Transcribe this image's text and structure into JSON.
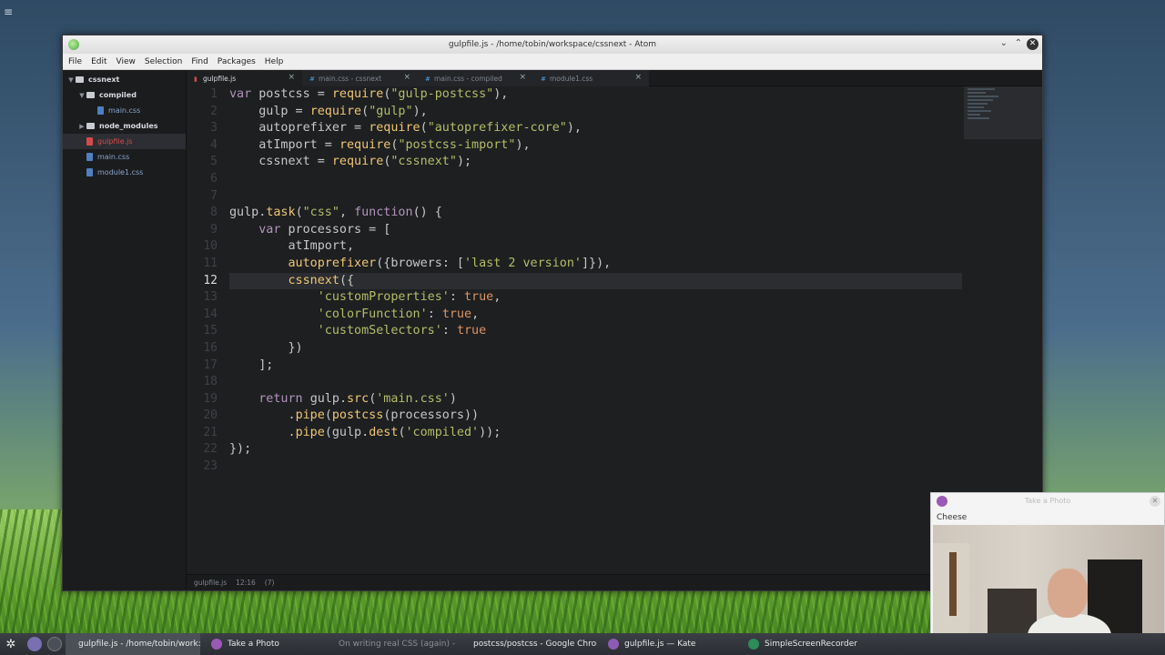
{
  "desktop": {
    "icon_glyph": "≡"
  },
  "atom_window": {
    "title": "gulpfile.js - /home/tobin/workspace/cssnext - Atom",
    "controls": {
      "minimize": "⌄",
      "maximize": "⌃",
      "close": "✕"
    },
    "menu": [
      "File",
      "Edit",
      "View",
      "Selection",
      "Find",
      "Packages",
      "Help"
    ],
    "tree": [
      {
        "label": "cssnext",
        "kind": "folder",
        "depth": 0,
        "expanded": true
      },
      {
        "label": "compiled",
        "kind": "folder",
        "depth": 1,
        "expanded": true
      },
      {
        "label": "main.css",
        "kind": "file",
        "depth": 2
      },
      {
        "label": "node_modules",
        "kind": "folder",
        "depth": 1,
        "expanded": false
      },
      {
        "label": "gulpfile.js",
        "kind": "file",
        "depth": 1,
        "selected": true
      },
      {
        "label": "main.css",
        "kind": "file",
        "depth": 1
      },
      {
        "label": "module1.css",
        "kind": "file",
        "depth": 1
      }
    ],
    "tabs": [
      {
        "label": "gulpfile.js",
        "active": true,
        "close": "×"
      },
      {
        "label": "main.css - cssnext",
        "active": false,
        "close": "×"
      },
      {
        "label": "main.css - compiled",
        "active": false,
        "close": "×"
      },
      {
        "label": "module1.css",
        "active": false,
        "close": "×"
      }
    ],
    "active_line": 12,
    "code_lines": [
      "var postcss = require(\"gulp-postcss\"),",
      "    gulp = require(\"gulp\"),",
      "    autoprefixer = require(\"autoprefixer-core\"),",
      "    atImport = require(\"postcss-import\"),",
      "    cssnext = require(\"cssnext\");",
      "",
      "",
      "gulp.task(\"css\", function() {",
      "    var processors = [",
      "        atImport,",
      "        autoprefixer({browers: ['last 2 version']}),",
      "        cssnext({",
      "            'customProperties': true,",
      "            'colorFunction': true,",
      "            'customSelectors': true",
      "        })",
      "    ];",
      "",
      "    return gulp.src('main.css')",
      "        .pipe(postcss(processors))",
      "        .pipe(gulp.dest('compiled'));",
      "});",
      ""
    ],
    "status": {
      "file": "gulpfile.js",
      "cursor": "12:16",
      "selection": "(7)"
    }
  },
  "photo_window": {
    "title": "Take a Photo",
    "label": "Cheese",
    "close": "✕"
  },
  "taskbar": {
    "launcher_glyph": "✲",
    "tasks": [
      {
        "label": "gulpfile.js - /home/tobin/work:",
        "active": true,
        "color": "#4fa34b",
        "dim": false
      },
      {
        "label": "Take a Photo",
        "active": false,
        "color": "#9b59b6",
        "dim": false
      },
      {
        "label": "On writing real CSS (again) - G",
        "active": false,
        "color": "#777777",
        "dim": true
      },
      {
        "label": "postcss/postcss - Google Chrom",
        "active": false,
        "color": "#e84c3d",
        "dim": false
      },
      {
        "label": "gulpfile.js — Kate",
        "active": false,
        "color": "#8e5bb3",
        "dim": false
      },
      {
        "label": "SimpleScreenRecorder",
        "active": false,
        "color": "#2c8c5a",
        "dim": false
      }
    ]
  },
  "colors": {
    "editor_bg": "#1d1f21",
    "keyword": "#b294bb",
    "function": "#f0c674",
    "string": "#b5bd68",
    "boolean": "#de935f"
  }
}
